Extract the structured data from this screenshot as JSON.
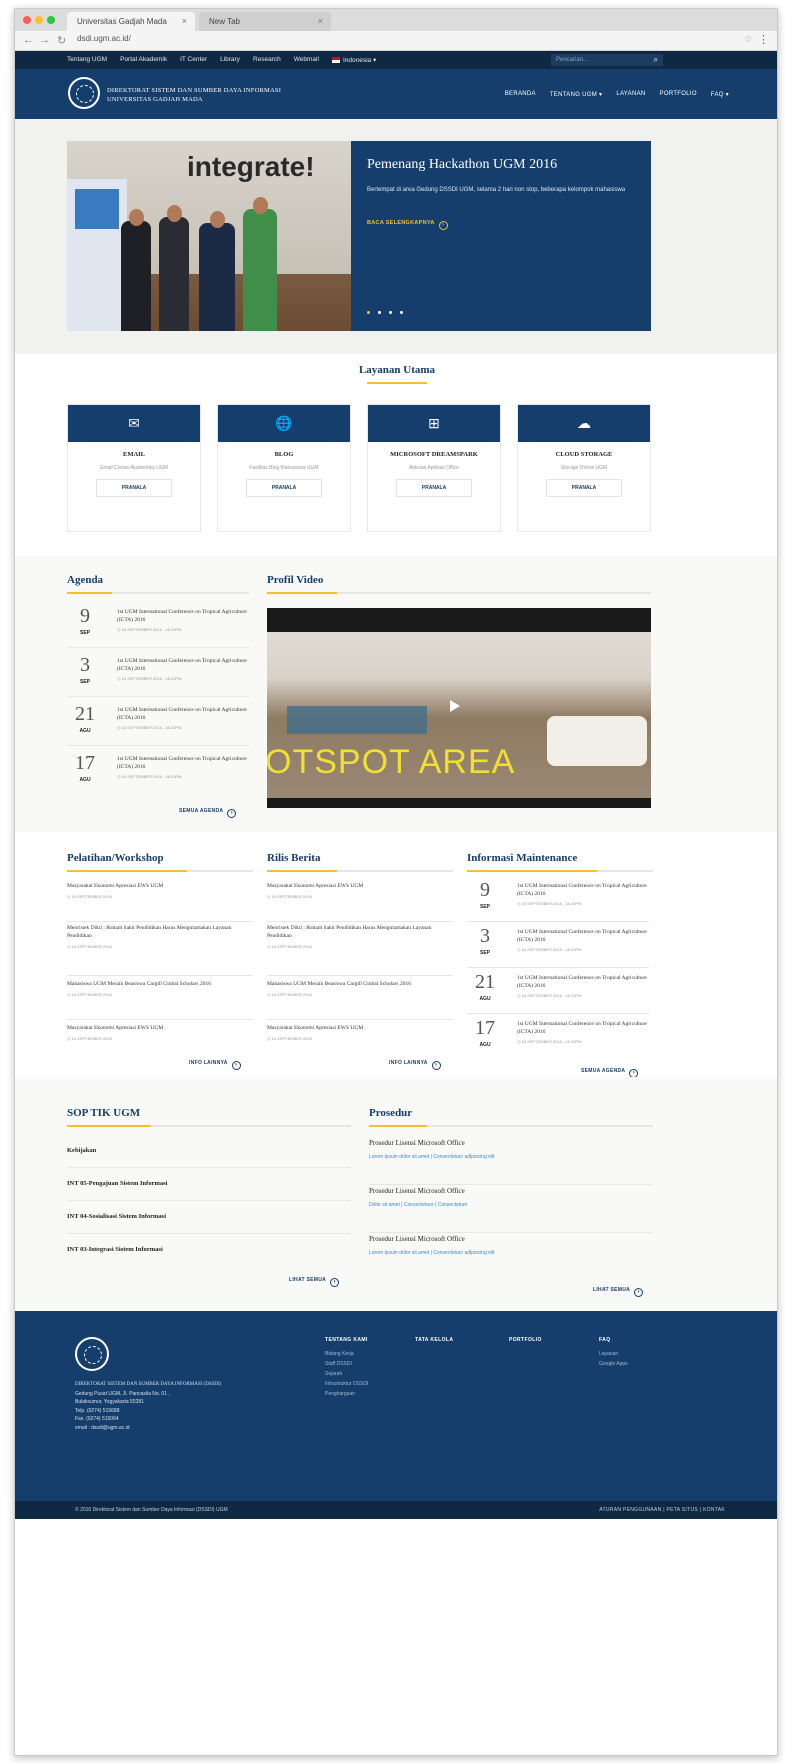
{
  "browser": {
    "tabs": [
      {
        "label": "Universitas Gadjah Mada"
      },
      {
        "label": "New Tab"
      }
    ],
    "url": "dsdi.ugm.ac.id/"
  },
  "topbar": {
    "links": [
      "Tentang UGM",
      "Portal Akademik",
      "IT Center",
      "Library",
      "Research",
      "Webmail"
    ],
    "language": "Indonesia",
    "search_placeholder": "Pencarian..."
  },
  "header": {
    "brand_line1": "DIREKTORAT SISTEM DAN SUMBER DAYA INFORMASI",
    "brand_line2": "UNIVERSITAS GADJAH MADA",
    "nav": [
      "BERANDA",
      "TENTANG UGM",
      "LAYANAN",
      "PORTFOLIO",
      "FAQ"
    ]
  },
  "hero": {
    "banner_word": "integrate!",
    "title": "Pemenang Hackathon UGM 2016",
    "text": "Bertempat di area Gedung DSSDI UGM, selama 2 hari non stop, beberapa kelompok mahasiswa",
    "more_label": "BACA SELENGKAPNYA",
    "slide_count": 4,
    "active_slide": 1
  },
  "services": {
    "title": "Layanan Utama",
    "items": [
      {
        "icon": "envelope-icon",
        "glyph": "✉",
        "name": "EMAIL",
        "desc": "Email Civitas Akademika UGM",
        "button": "PRANALA"
      },
      {
        "icon": "globe-icon",
        "glyph": "🌐",
        "name": "BLOG",
        "desc": "Fasilitas Blog Mahasiswa UGM",
        "button": "PRANALA"
      },
      {
        "icon": "windows-icon",
        "glyph": "⊞",
        "name": "MICROSOFT DREAMSPARK",
        "desc": "Aktivasi Aplikasi Office",
        "button": "PRANALA"
      },
      {
        "icon": "cloud-icon",
        "glyph": "☁",
        "name": "CLOUD STORAGE",
        "desc": "Storage Online UGM",
        "button": "PRANALA"
      }
    ]
  },
  "agenda": {
    "title": "Agenda",
    "events": [
      {
        "day": "9",
        "month": "SEP",
        "title": "1st UGM International Conference on Tropical Agriculture (ICTA) 2016",
        "date": "16 SEPTEMBER 2016 - 16.20PM"
      },
      {
        "day": "3",
        "month": "SEP",
        "title": "1st UGM International Conference on Tropical Agriculture (ICTA) 2016",
        "date": "16 SEPTEMBER 2016 - 16.20PM"
      },
      {
        "day": "21",
        "month": "AGU",
        "title": "1st UGM International Conference on Tropical Agriculture (ICTA) 2016",
        "date": "16 SEPTEMBER 2016 - 16.20PM"
      },
      {
        "day": "17",
        "month": "AGU",
        "title": "1st UGM International Conference on Tropical Agriculture (ICTA) 2016",
        "date": "16 SEPTEMBER 2016 - 16.20PM"
      }
    ],
    "more_label": "SEMUA AGENDA"
  },
  "video": {
    "title": "Profil Video",
    "overlay_text": "OTSPOT AREA"
  },
  "training": {
    "title": "Pelatihan/Workshop",
    "items": [
      {
        "title": "Masyarakat Ekonomi Apresiasi EWS UGM",
        "date": "16 SEPTEMBER 2016"
      },
      {
        "title": "Menristek Dikti : Rumah Sakit Pendidikan Harus Mengutamakan Layanan Pendidikan",
        "date": "16 SEPTEMBER 2016"
      },
      {
        "title": "Mahasiswa UGM Meraih Beasiswa Cargill Global Scholars 2016",
        "date": "16 SEPTEMBER 2016"
      },
      {
        "title": "Masyarakat Ekonomi Apresiasi EWS UGM",
        "date": "16 SEPTEMBER 2016"
      }
    ],
    "more_label": "INFO LAINNYA"
  },
  "press": {
    "title": "Rilis Berita",
    "items": [
      {
        "title": "Masyarakat Ekonomi Apresiasi EWS UGM",
        "date": "16 SEPTEMBER 2016"
      },
      {
        "title": "Menristek Dikti : Rumah Sakit Pendidikan Harus Mengutamakan Layanan Pendidikan",
        "date": "16 SEPTEMBER 2016"
      },
      {
        "title": "Mahasiswa UGM Meraih Beasiswa Cargill Global Scholars 2016",
        "date": "16 SEPTEMBER 2016"
      },
      {
        "title": "Masyarakat Ekonomi Apresiasi EWS UGM",
        "date": "16 SEPTEMBER 2016"
      }
    ],
    "more_label": "INFO LAINNYA"
  },
  "maintenance": {
    "title": "Informasi Maintenance",
    "events": [
      {
        "day": "9",
        "month": "SEP",
        "title": "1st UGM International Conference on Tropical Agriculture (ICTA) 2016",
        "date": "16 SEPTEMBER 2016 - 16.20PM"
      },
      {
        "day": "3",
        "month": "SEP",
        "title": "1st UGM International Conference on Tropical Agriculture (ICTA) 2016",
        "date": "16 SEPTEMBER 2016 - 16.20PM"
      },
      {
        "day": "21",
        "month": "AGU",
        "title": "1st UGM International Conference on Tropical Agriculture (ICTA) 2016",
        "date": "16 SEPTEMBER 2016 - 16.20PM"
      },
      {
        "day": "17",
        "month": "AGU",
        "title": "1st UGM International Conference on Tropical Agriculture (ICTA) 2016",
        "date": "16 SEPTEMBER 2016 - 16.20PM"
      }
    ],
    "more_label": "SEMUA AGENDA"
  },
  "sop": {
    "title": "SOP TIK UGM",
    "items": [
      "Kebijakan",
      "INT 05-Pengajuan Sistem Informasi",
      "INT 04-Sosialisasi Sistem Informasi",
      "INT 03-Integrasi Sistem Informasi"
    ],
    "more_label": "LIHAT SEMUA"
  },
  "procedures": {
    "title": "Prosedur",
    "items": [
      {
        "title": "Prosedur Lisensi Microsoft Office",
        "links": "Lorem ipsum dolor sit amet | Consectetuer adipiscing elit"
      },
      {
        "title": "Prosedur Lisensi Microsoft Office",
        "links": "Dolor sit amet | Consectetuer | Consectetuer"
      },
      {
        "title": "Prosedur Lisensi Microsoft Office",
        "links": "Lorem ipsum dolor sit amet | Consectetuer adipiscing elit"
      }
    ],
    "more_label": "LIHAT SEMUA"
  },
  "footer": {
    "name": "DIREKTORAT SISTEM DAN SUMBER DAYA INFORMASI (DSSDI)",
    "address1": "Gedung Pusat UGM, Jl. Pancasila No. 01 ,",
    "address2": "Bulaksumur, Yogyakarta 55281",
    "phone": "Telp. (0274) 515688",
    "fax": "Fax. (0274) 515064",
    "email": "email : dssdi@ugm.ac.id",
    "col1_title": "TENTANG KAMI",
    "col1_links": [
      "Bidang Kerja",
      "Staff DSSDI",
      "Sejarah",
      "Infrastruktur DSSDI",
      "Penghargaan"
    ],
    "col2_title": "TATA KELOLA",
    "col3_title": "PORTFOLIO",
    "col4_title": "FAQ",
    "col4_links": [
      "Layanan",
      "Google Apps"
    ],
    "copyright": "© 2016 Direktorat Sistem dan Sumber Daya Informasi (DSSDI) UGM",
    "bottom_links": "ATURAN PENGGUNAAN  |  PETA SITUS  |  KONTAK"
  },
  "colors": {
    "primary": "#153e6d",
    "dark": "#0f2844",
    "accent": "#f3c12c"
  }
}
